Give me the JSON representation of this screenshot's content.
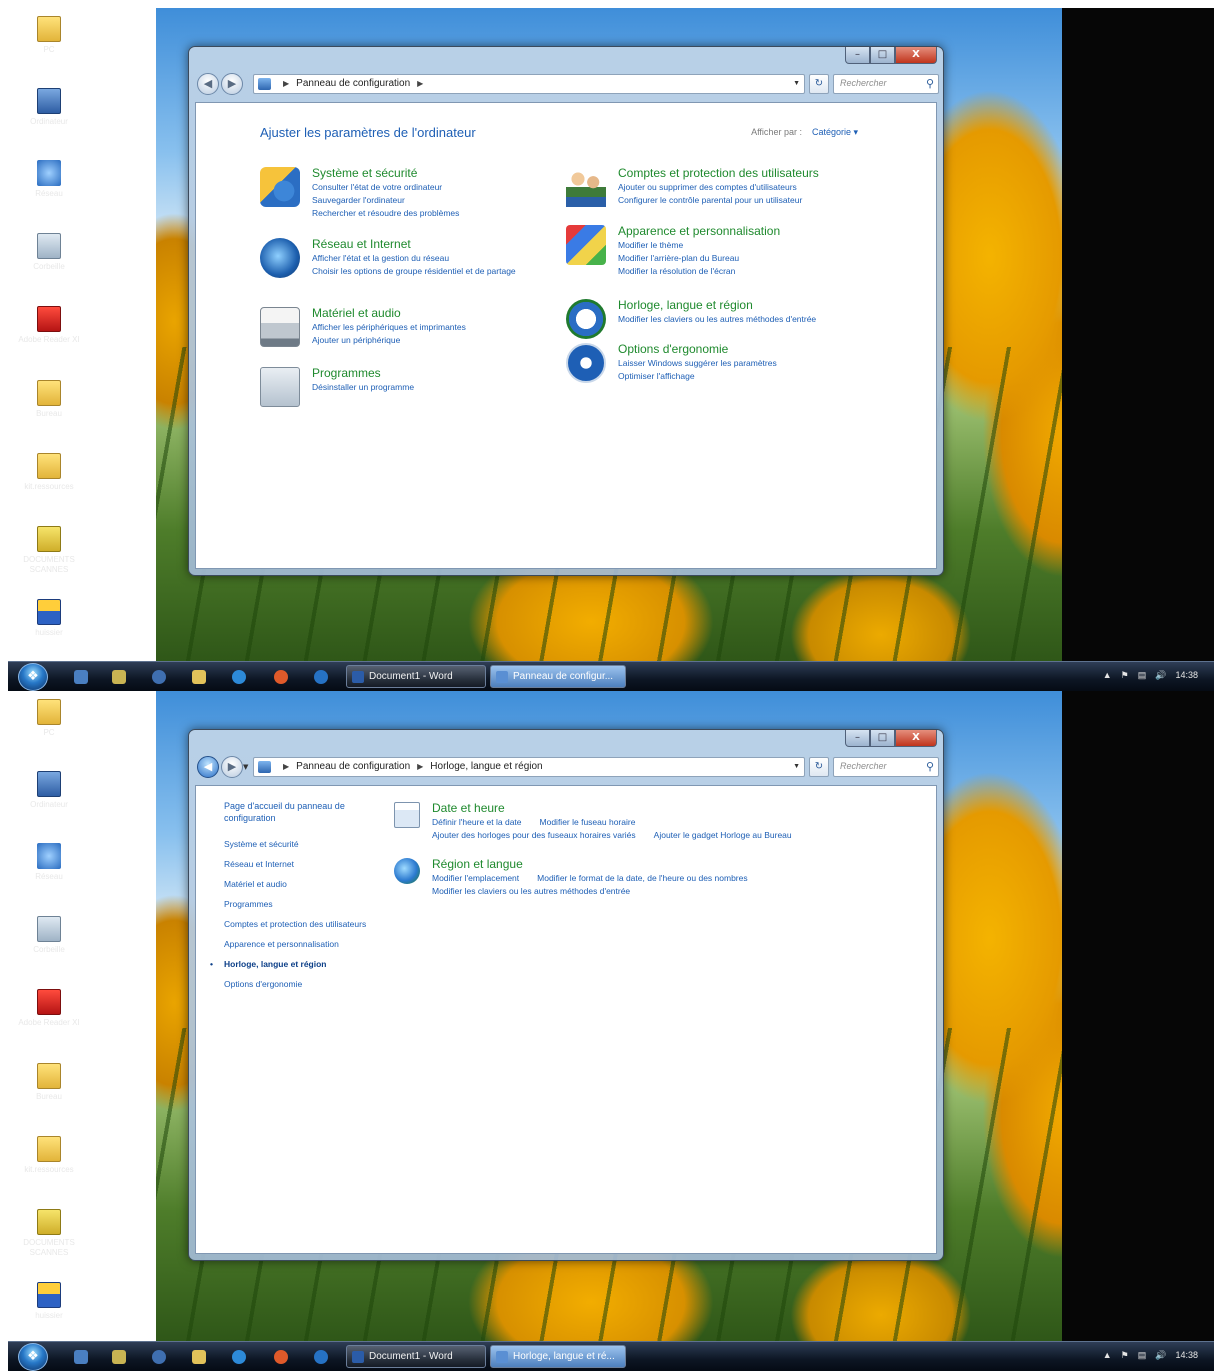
{
  "desktop": {
    "icons": [
      {
        "label": "PC",
        "icon": "computer-icon"
      },
      {
        "label": "Ordinateur",
        "icon": "computer-icon"
      },
      {
        "label": "Réseau",
        "icon": "network-icon"
      },
      {
        "label": "Corbeille",
        "icon": "recycle-bin-icon"
      },
      {
        "label": "Adobe Reader XI",
        "icon": "pdf-icon"
      },
      {
        "label": "Bureau",
        "icon": "folder-icon"
      },
      {
        "label": "kit.ressources",
        "icon": "folder-icon"
      },
      {
        "label": "DOCUMENTS SCANNES",
        "icon": "document-icon"
      },
      {
        "label": "huissier",
        "icon": "shortcut-icon"
      }
    ]
  },
  "screen1": {
    "window": {
      "controls": {
        "minimize": "–",
        "maximize": "□",
        "close": "X"
      },
      "address": {
        "crumbs": [
          "Panneau de configuration"
        ],
        "search_placeholder": "Rechercher"
      },
      "title": "Ajuster les paramètres de l'ordinateur",
      "view_by_label": "Afficher par :",
      "view_by_value": "Catégorie ▾",
      "categories": [
        {
          "title": "Système et sécurité",
          "icon": "shield-icon",
          "links": [
            "Consulter l'état de votre ordinateur",
            "Sauvegarder l'ordinateur",
            "Rechercher et résoudre des problèmes"
          ]
        },
        {
          "title": "Réseau et Internet",
          "icon": "globe-icon",
          "links": [
            "Afficher l'état et la gestion du réseau",
            "Choisir les options de groupe résidentiel et de partage"
          ]
        },
        {
          "title": "Matériel et audio",
          "icon": "printer-icon",
          "links": [
            "Afficher les périphériques et imprimantes",
            "Ajouter un périphérique"
          ]
        },
        {
          "title": "Programmes",
          "icon": "programs-icon",
          "links": [
            "Désinstaller un programme"
          ]
        },
        {
          "title": "Comptes et protection des utilisateurs",
          "icon": "users-icon",
          "links": [
            "Ajouter ou supprimer des comptes d'utilisateurs",
            "Configurer le contrôle parental pour un utilisateur"
          ]
        },
        {
          "title": "Apparence et personnalisation",
          "icon": "paint-icon",
          "links": [
            "Modifier le thème",
            "Modifier l'arrière-plan du Bureau",
            "Modifier la résolution de l'écran"
          ]
        },
        {
          "title": "Horloge, langue et région",
          "icon": "clock-icon",
          "links": [
            "Modifier les claviers ou les autres méthodes d'entrée"
          ]
        },
        {
          "title": "Options d'ergonomie",
          "icon": "accessibility-icon",
          "links": [
            "Laisser Windows suggérer les paramètres",
            "Optimiser l'affichage"
          ]
        }
      ]
    },
    "taskbar": {
      "items": [
        "Document1 - Word",
        "Panneau de configur..."
      ],
      "time": "14:38"
    }
  },
  "screen2": {
    "window": {
      "controls": {
        "minimize": "–",
        "maximize": "□",
        "close": "X"
      },
      "address": {
        "crumbs": [
          "Panneau de configuration",
          "Horloge, langue et région"
        ],
        "search_placeholder": "Rechercher"
      },
      "sidebar": {
        "home": "Page d'accueil du panneau de configuration",
        "items": [
          "Système et sécurité",
          "Réseau et Internet",
          "Matériel et audio",
          "Programmes",
          "Comptes et protection des utilisateurs",
          "Apparence et personnalisation",
          "Horloge, langue et région",
          "Options d'ergonomie"
        ],
        "current": "Horloge, langue et région"
      },
      "tasks": [
        {
          "title": "Date et heure",
          "icon": "calendar-clock-icon",
          "rows": [
            [
              "Définir l'heure et la date",
              "Modifier le fuseau horaire"
            ],
            [
              "Ajouter des horloges pour des fuseaux horaires variés",
              "Ajouter le gadget Horloge au Bureau"
            ]
          ]
        },
        {
          "title": "Région et langue",
          "icon": "globe-icon",
          "rows": [
            [
              "Modifier l'emplacement",
              "Modifier le format de la date, de l'heure ou des nombres"
            ],
            [
              "Modifier les claviers ou les autres méthodes d'entrée"
            ]
          ]
        }
      ]
    },
    "taskbar": {
      "items": [
        "Document1 - Word",
        "Horloge, langue et ré..."
      ],
      "time": "14:38"
    }
  }
}
